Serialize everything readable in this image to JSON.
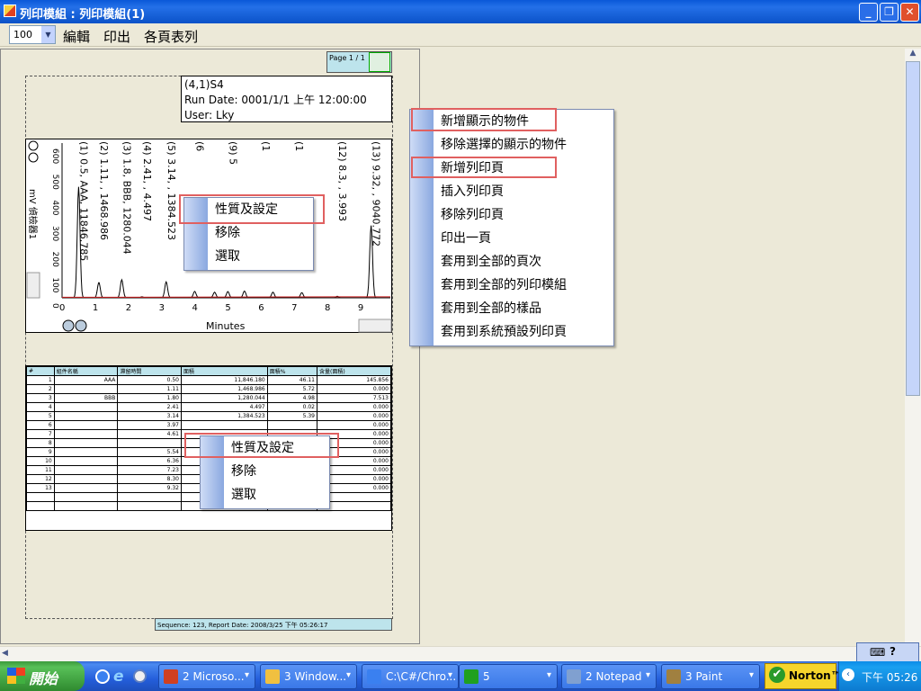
{
  "window": {
    "title": "列印模組 : 列印模組(1)",
    "minimize": "_",
    "restore": "❐",
    "close": "✕"
  },
  "toolbar": {
    "zoom_value": "100",
    "menus": [
      "編輯",
      "印出",
      "各頁表列"
    ]
  },
  "page": {
    "page_label": "Page 1 / 1",
    "info": [
      "(4,1)S4",
      "Run  Date:  0001/1/1 上午 12:00:00",
      "User: Lky"
    ],
    "footer": "Sequence:  123,  Report  Date:  2008/3/25  下午 05:26:17"
  },
  "chart_data": {
    "type": "line",
    "xlabel": "Minutes",
    "ylabel": "mV 偵檢器1",
    "x_ticks": [
      "0",
      "1",
      "2",
      "3",
      "4",
      "5",
      "6",
      "7",
      "8",
      "9"
    ],
    "y_ticks": [
      "0",
      "100",
      "200",
      "300",
      "400",
      "500",
      "600"
    ],
    "xlim": [
      0,
      9.9
    ],
    "ylim": [
      0,
      600
    ],
    "peak_labels": [
      "(1) 0.5, AAA, 11846.785",
      "(2) 1.11, , 1468.986",
      "(3) 1.8, BBB, 1280.044",
      "(4) 2.41, , 4.497",
      "(5) 3.14, , 1384.523",
      "(6",
      "(9) 5",
      "(1",
      "(1",
      "(12) 8.3, , 3.993",
      "(13) 9.32, , 9040.772"
    ]
  },
  "table": {
    "headers": [
      "#",
      "組件名稱",
      "滯留時間",
      "面積",
      "面積%",
      "含量(面積)"
    ],
    "rows": [
      [
        "1",
        "AAA",
        "0.50",
        "11,846.180",
        "46.11",
        "145.856"
      ],
      [
        "2",
        "",
        "1.11",
        "1,468.986",
        "5.72",
        "0.000"
      ],
      [
        "3",
        "BBB",
        "1.80",
        "1,280.044",
        "4.98",
        "7.513"
      ],
      [
        "4",
        "",
        "2.41",
        "4.497",
        "0.02",
        "0.000"
      ],
      [
        "5",
        "",
        "3.14",
        "1,384.523",
        "5.39",
        "0.000"
      ],
      [
        "6",
        "",
        "3.97",
        "",
        "",
        "0.000"
      ],
      [
        "7",
        "",
        "4.61",
        "",
        "",
        "0.000"
      ],
      [
        "8",
        "",
        "",
        "",
        "",
        "0.000"
      ],
      [
        "9",
        "",
        "5.54",
        "",
        "",
        "0.000"
      ],
      [
        "10",
        "",
        "6.36",
        "",
        "",
        "0.000"
      ],
      [
        "11",
        "",
        "7.23",
        "",
        "",
        "0.000"
      ],
      [
        "12",
        "",
        "8.30",
        "",
        "",
        "0.000"
      ],
      [
        "13",
        "",
        "9.32",
        "",
        "",
        "0.000"
      ]
    ]
  },
  "ctx_main": [
    "新增顯示的物件",
    "移除選擇的顯示的物件",
    "新增列印頁",
    "插入列印頁",
    "移除列印頁",
    "印出一頁",
    "套用到全部的頁次",
    "套用到全部的列印模組",
    "套用到全部的樣品",
    "套用到系統預設列印頁"
  ],
  "ctx_chart": [
    "性質及設定",
    "移除",
    "選取"
  ],
  "ctx_table": [
    "性質及設定",
    "移除",
    "選取"
  ],
  "taskbar": {
    "start": "開始",
    "tasks": [
      "2 Microso...",
      "3 Window...",
      "C:\\C#/Chro...",
      "5",
      "2 Notepad",
      "3 Paint"
    ],
    "norton": "Norton™",
    "clock": "下午 05:26"
  },
  "colors": {
    "highlight_box": "#e06060",
    "chart_line": "#000000",
    "baseline": "#d02020"
  }
}
